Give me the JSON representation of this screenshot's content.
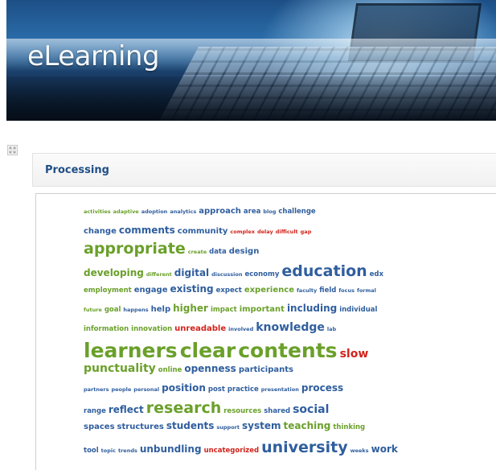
{
  "banner": {
    "title": "eLearning"
  },
  "block": {
    "title": "Processing"
  },
  "cloud": {
    "lines": [
      {
        "words": [
          {
            "t": "activities",
            "c": "g",
            "s": 1
          },
          {
            "t": "adaptive",
            "c": "g",
            "s": 1
          },
          {
            "t": "adoption",
            "c": "b",
            "s": 1
          },
          {
            "t": "analytics",
            "c": "b",
            "s": 1
          },
          {
            "t": "approach",
            "c": "b",
            "s": 3
          },
          {
            "t": "area",
            "c": "b",
            "s": 2
          },
          {
            "t": "blog",
            "c": "b",
            "s": 1
          },
          {
            "t": "challenge",
            "c": "b",
            "s": 2
          }
        ]
      },
      {
        "words": [
          {
            "t": "change",
            "c": "b",
            "s": 3
          },
          {
            "t": "comments",
            "c": "b",
            "s": 4
          },
          {
            "t": "community",
            "c": "b",
            "s": 3
          },
          {
            "t": "complex",
            "c": "r",
            "s": 1
          },
          {
            "t": "delay",
            "c": "r",
            "s": 1
          },
          {
            "t": "difficult",
            "c": "r",
            "s": 1
          },
          {
            "t": "gap",
            "c": "r",
            "s": 1
          }
        ]
      },
      {
        "words": [
          {
            "t": "appropriate",
            "c": "g",
            "s": 6
          },
          {
            "t": "create",
            "c": "g",
            "s": 1
          },
          {
            "t": "data",
            "c": "b",
            "s": 2
          },
          {
            "t": "design",
            "c": "b",
            "s": 3
          }
        ]
      },
      {
        "words": [
          {
            "t": "developing",
            "c": "g",
            "s": 4
          },
          {
            "t": "different",
            "c": "g",
            "s": 1
          },
          {
            "t": "digital",
            "c": "b",
            "s": 4
          },
          {
            "t": "discussion",
            "c": "b",
            "s": 1
          },
          {
            "t": "economy",
            "c": "b",
            "s": 2
          },
          {
            "t": "education",
            "c": "b",
            "s": 6
          },
          {
            "t": "edx",
            "c": "b",
            "s": 2
          }
        ]
      },
      {
        "words": [
          {
            "t": "employment",
            "c": "g",
            "s": 2
          },
          {
            "t": "engage",
            "c": "b",
            "s": 3
          },
          {
            "t": "existing",
            "c": "b",
            "s": 4
          },
          {
            "t": "expect",
            "c": "b",
            "s": 2
          },
          {
            "t": "experience",
            "c": "g",
            "s": 3
          },
          {
            "t": "faculty",
            "c": "b",
            "s": 1
          },
          {
            "t": "field",
            "c": "b",
            "s": 2
          },
          {
            "t": "focus",
            "c": "b",
            "s": 1
          },
          {
            "t": "formal",
            "c": "b",
            "s": 1
          }
        ]
      },
      {
        "words": [
          {
            "t": "future",
            "c": "g",
            "s": 1
          },
          {
            "t": "goal",
            "c": "g",
            "s": 2
          },
          {
            "t": "happens",
            "c": "b",
            "s": 1
          },
          {
            "t": "help",
            "c": "b",
            "s": 3
          },
          {
            "t": "higher",
            "c": "g",
            "s": 4
          },
          {
            "t": "impact",
            "c": "g",
            "s": 2
          },
          {
            "t": "important",
            "c": "g",
            "s": 3
          },
          {
            "t": "including",
            "c": "b",
            "s": 4
          },
          {
            "t": "individual",
            "c": "b",
            "s": 2
          }
        ]
      },
      {
        "words": [
          {
            "t": "information",
            "c": "g",
            "s": 2
          },
          {
            "t": "innovation",
            "c": "g",
            "s": 2
          },
          {
            "t": "unreadable",
            "c": "r",
            "s": 3
          },
          {
            "t": "involved",
            "c": "b",
            "s": 1
          },
          {
            "t": "knowledge",
            "c": "b",
            "s": 5
          },
          {
            "t": "lab",
            "c": "b",
            "s": 1
          }
        ]
      },
      {
        "words": [
          {
            "t": "learners",
            "c": "g",
            "s": 7
          },
          {
            "t": "clear",
            "c": "g",
            "s": 7
          },
          {
            "t": "contents",
            "c": "g",
            "s": 7
          },
          {
            "t": "slow",
            "c": "r",
            "s": 5
          }
        ]
      },
      {
        "words": [
          {
            "t": "punctuality",
            "c": "g",
            "s": 5
          },
          {
            "t": "online",
            "c": "g",
            "s": 2
          },
          {
            "t": "openness",
            "c": "b",
            "s": 4
          },
          {
            "t": "participants",
            "c": "b",
            "s": 3
          }
        ]
      },
      {
        "words": [
          {
            "t": "partners",
            "c": "b",
            "s": 1
          },
          {
            "t": "people",
            "c": "b",
            "s": 1
          },
          {
            "t": "personal",
            "c": "b",
            "s": 1
          },
          {
            "t": "position",
            "c": "b",
            "s": 4
          },
          {
            "t": "post",
            "c": "b",
            "s": 2
          },
          {
            "t": "practice",
            "c": "b",
            "s": 2
          },
          {
            "t": "presentation",
            "c": "b",
            "s": 1
          },
          {
            "t": "process",
            "c": "b",
            "s": 4
          }
        ]
      },
      {
        "words": [
          {
            "t": "range",
            "c": "b",
            "s": 2
          },
          {
            "t": "reflect",
            "c": "b",
            "s": 4
          },
          {
            "t": "research",
            "c": "g",
            "s": 6
          },
          {
            "t": "resources",
            "c": "g",
            "s": 2
          },
          {
            "t": "shared",
            "c": "b",
            "s": 2
          },
          {
            "t": "social",
            "c": "b",
            "s": 5
          }
        ]
      },
      {
        "words": [
          {
            "t": "spaces",
            "c": "b",
            "s": 3
          },
          {
            "t": "structures",
            "c": "b",
            "s": 3
          },
          {
            "t": "students",
            "c": "b",
            "s": 4
          },
          {
            "t": "support",
            "c": "b",
            "s": 1
          },
          {
            "t": "system",
            "c": "b",
            "s": 4
          },
          {
            "t": "teaching",
            "c": "g",
            "s": 4
          },
          {
            "t": "thinking",
            "c": "g",
            "s": 2
          }
        ]
      },
      {
        "words": [
          {
            "t": "tool",
            "c": "b",
            "s": 2
          },
          {
            "t": "topic",
            "c": "b",
            "s": 1
          },
          {
            "t": "trends",
            "c": "b",
            "s": 1
          },
          {
            "t": "unbundling",
            "c": "b",
            "s": 4
          },
          {
            "t": "uncategorized",
            "c": "r",
            "s": 2
          },
          {
            "t": "university",
            "c": "b",
            "s": 6
          },
          {
            "t": "weeks",
            "c": "b",
            "s": 1
          },
          {
            "t": "work",
            "c": "b",
            "s": 4
          }
        ]
      }
    ]
  }
}
